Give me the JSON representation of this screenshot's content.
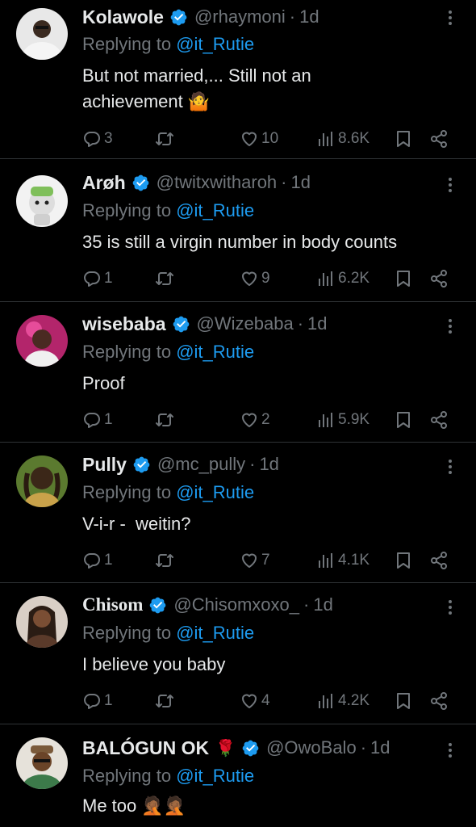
{
  "tweets": [
    {
      "name": "Kolawole",
      "handle": "@rhaymoni",
      "time": "1d",
      "replying_label": "Replying to",
      "replying_to": "@it_Rutie",
      "text": "But not married,... Still not an achievement 🤷",
      "replies": "3",
      "likes": "10",
      "views": "8.6K"
    },
    {
      "name": "Arøh",
      "handle": "@twitxwitharoh",
      "time": "1d",
      "replying_label": "Replying to",
      "replying_to": "@it_Rutie",
      "text": "35 is still a virgin number in body counts",
      "replies": "1",
      "likes": "9",
      "views": "6.2K"
    },
    {
      "name": "wisebaba",
      "handle": "@Wizebaba",
      "time": "1d",
      "replying_label": "Replying to",
      "replying_to": "@it_Rutie",
      "text": "Proof",
      "replies": "1",
      "likes": "2",
      "views": "5.9K"
    },
    {
      "name": "Pully",
      "handle": "@mc_pully",
      "time": "1d",
      "replying_label": "Replying to",
      "replying_to": "@it_Rutie",
      "text": "V-i-r -  weitin?",
      "replies": "1",
      "likes": "7",
      "views": "4.1K"
    },
    {
      "name": "Chisom",
      "handle": "@Chisomxoxo_",
      "time": "1d",
      "replying_label": "Replying to",
      "replying_to": "@it_Rutie",
      "text": "I believe you baby",
      "replies": "1",
      "likes": "4",
      "views": "4.2K"
    },
    {
      "name": "BALÓGUN OK",
      "name_emoji": "🌹",
      "handle": "@OwoBalo",
      "time": "1d",
      "replying_label": "Replying to",
      "replying_to": "@it_Rutie",
      "text": "Me too 🤦🏾🤦🏾"
    }
  ],
  "colors": {
    "background": "#000000",
    "text": "#e7e9ea",
    "muted": "#71767b",
    "accent": "#1d9bf0",
    "divider": "#2f3336"
  },
  "icons": [
    "verified-badge-icon",
    "more-icon",
    "reply-icon",
    "retweet-icon",
    "like-icon",
    "views-icon",
    "bookmark-icon",
    "share-icon"
  ]
}
